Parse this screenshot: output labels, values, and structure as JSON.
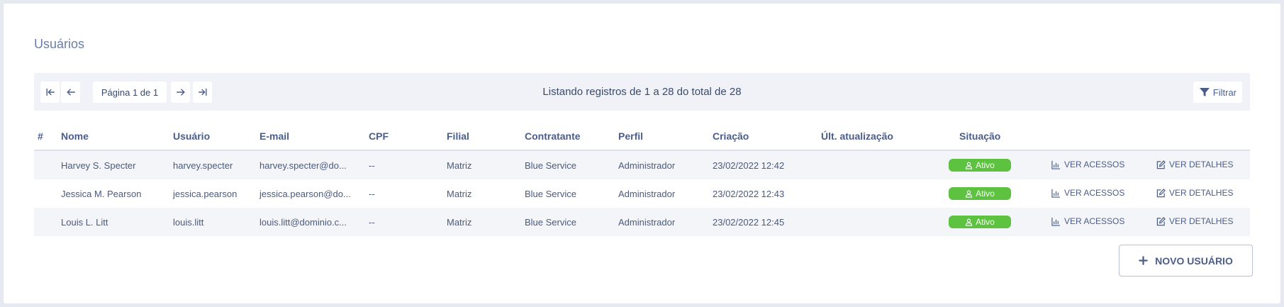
{
  "page": {
    "title": "Usuários"
  },
  "toolbar": {
    "page_indicator": "Página 1 de 1",
    "listing_info": "Listando registros de 1 a 28 do total de 28",
    "filter_label": "Filtrar"
  },
  "table": {
    "headers": {
      "index": "#",
      "nome": "Nome",
      "usuario": "Usuário",
      "email": "E-mail",
      "cpf": "CPF",
      "filial": "Filial",
      "contratante": "Contratante",
      "perfil": "Perfil",
      "criacao": "Criação",
      "ult_atualizacao": "Últ. atualização",
      "situacao": "Situação"
    },
    "rows": [
      {
        "nome": "Harvey S. Specter",
        "usuario": "harvey.specter",
        "email": "harvey.specter@do...",
        "cpf": "--",
        "filial": "Matriz",
        "contratante": "Blue Service",
        "perfil": "Administrador",
        "criacao": "23/02/2022 12:42",
        "ult_atualizacao": "",
        "situacao": "Ativo",
        "ver_acessos": "VER ACESSOS",
        "ver_detalhes": "VER DETALHES"
      },
      {
        "nome": "Jessica M. Pearson",
        "usuario": "jessica.pearson",
        "email": "jessica.pearson@do...",
        "cpf": "--",
        "filial": "Matriz",
        "contratante": "Blue Service",
        "perfil": "Administrador",
        "criacao": "23/02/2022 12:43",
        "ult_atualizacao": "",
        "situacao": "Ativo",
        "ver_acessos": "VER ACESSOS",
        "ver_detalhes": "VER DETALHES"
      },
      {
        "nome": "Louis L. Litt",
        "usuario": "louis.litt",
        "email": "louis.litt@dominio.c...",
        "cpf": "--",
        "filial": "Matriz",
        "contratante": "Blue Service",
        "perfil": "Administrador",
        "criacao": "23/02/2022 12:45",
        "ult_atualizacao": "",
        "situacao": "Ativo",
        "ver_acessos": "VER ACESSOS",
        "ver_detalhes": "VER DETALHES"
      }
    ]
  },
  "actions": {
    "new_user_label": "NOVO USUÁRIO"
  },
  "colors": {
    "background": "#e7e9f1",
    "accent": "#4b5d8a",
    "status_active": "#5cc240",
    "title": "#6a7fa8"
  },
  "icons": {
    "first_page": "first-page-icon",
    "prev_page": "arrow-left-icon",
    "next_page": "arrow-right-icon",
    "last_page": "last-page-icon",
    "filter": "funnel-icon",
    "status": "user-icon",
    "access": "bar-chart-icon",
    "details": "edit-icon",
    "add": "plus-icon"
  }
}
